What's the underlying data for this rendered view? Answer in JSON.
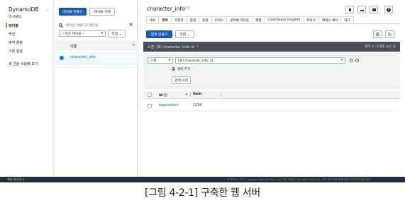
{
  "nav": {
    "title": "DynamoDB",
    "collapse_icon": "chevron-left-icon",
    "items": [
      "대시보드",
      "테이블",
      "백업",
      "예약 용량",
      "기본 설정",
      "새 콘솔 사용해 보기"
    ]
  },
  "table_list": {
    "create_button": "테이블 만들기",
    "delete_button": "테이블 삭제",
    "search_placeholder": "테이블 이름으로 필터링",
    "category_select": "-- 모든 테이블 --",
    "actions_button": "작업 ⌄",
    "column_header": "이름",
    "sort_icon": "sort-icon",
    "rows": [
      "character_info"
    ]
  },
  "main": {
    "title": "character_info",
    "help_link": "닫기",
    "tabs": [
      "개요",
      "항목",
      "측정치",
      "알람",
      "용량",
      "인덱스",
      "글로벌 테이블",
      "백업",
      "Contributor Insights",
      "트리거",
      "액세스 제어",
      "태그"
    ],
    "active_tab": "항목",
    "create_item_button": "항목 만들기",
    "actions_button": "작업 ⌄",
    "scan_label": "스캔: [표] character_info: id",
    "item_count": "항목 1~1개를 보는 중",
    "scan_type_select": "스캔",
    "table_select": "[표] character_info: id",
    "add_filter": "필터 추가",
    "start_search_button": "검색 시작",
    "grid_headers": [
      "id",
      "item"
    ],
    "grid_rows": [
      {
        "id": "teapmotion",
        "item": "1234"
      }
    ]
  },
  "footer": {
    "left": "개요   한국어 ▾",
    "right": "© 2008 - 2021, Amazon Web Services, Inc. 또는 계열사. All rights reserved.      개인 정보 보호 정책      이용 약관      쿠키 기본 설정"
  },
  "caption": "[그림 4-2-1] 구축한 웹 서버"
}
